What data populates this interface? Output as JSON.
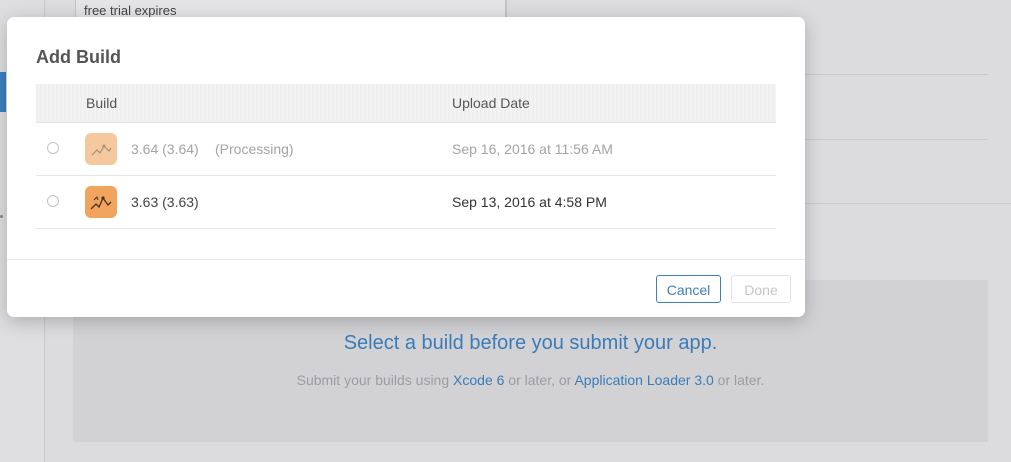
{
  "background": {
    "field_text": "free trial expires",
    "empty_state": {
      "title": "Select a build before you submit your app.",
      "subtitle_prefix": "Submit your builds using ",
      "link_xcode": "Xcode 6",
      "subtitle_middle": " or later, or ",
      "link_loader": "Application Loader 3.0",
      "subtitle_suffix": " or later."
    }
  },
  "modal": {
    "title": "Add Build",
    "columns": {
      "build": "Build",
      "upload_date": "Upload Date"
    },
    "rows": [
      {
        "version": "3.64 (3.64)",
        "status": "(Processing)",
        "date": "Sep 16, 2016 at 11:56 AM",
        "selected": false,
        "icon": "app-icon"
      },
      {
        "version": "3.63 (3.63)",
        "status": "",
        "date": "Sep 13, 2016 at 4:58 PM",
        "selected": false,
        "icon": "app-icon"
      }
    ],
    "buttons": {
      "cancel": "Cancel",
      "done": "Done"
    }
  },
  "colors": {
    "accent": "#3f7fbc",
    "icon_bg": "#f0a45d",
    "overlay": "#dcdcde"
  }
}
